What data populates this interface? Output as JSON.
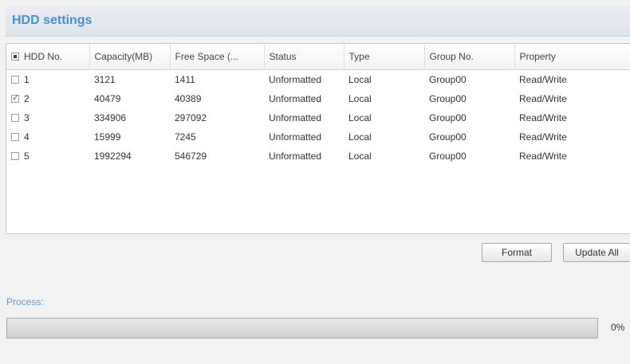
{
  "title": "HDD settings",
  "table": {
    "columns": [
      "HDD No.",
      "Capacity(MB)",
      "Free Space (...",
      "Status",
      "Type",
      "Group No.",
      "Property"
    ],
    "select_all_state": "partial",
    "rows": [
      {
        "checked": false,
        "hdd_no": "1",
        "capacity": "3121",
        "free_space": "1411",
        "status": "Unformatted",
        "type": "Local",
        "group": "Group00",
        "property": "Read/Write"
      },
      {
        "checked": true,
        "hdd_no": "2",
        "capacity": "40479",
        "free_space": "40389",
        "status": "Unformatted",
        "type": "Local",
        "group": "Group00",
        "property": "Read/Write"
      },
      {
        "checked": false,
        "hdd_no": "3",
        "capacity": "334906",
        "free_space": "297092",
        "status": "Unformatted",
        "type": "Local",
        "group": "Group00",
        "property": "Read/Write"
      },
      {
        "checked": false,
        "hdd_no": "4",
        "capacity": "15999",
        "free_space": "7245",
        "status": "Unformatted",
        "type": "Local",
        "group": "Group00",
        "property": "Read/Write"
      },
      {
        "checked": false,
        "hdd_no": "5",
        "capacity": "1992294",
        "free_space": "546729",
        "status": "Unformatted",
        "type": "Local",
        "group": "Group00",
        "property": "Read/Write"
      }
    ]
  },
  "buttons": {
    "format": "Format",
    "update_all": "Update All"
  },
  "process": {
    "label": "Process:",
    "percent_text": "0%",
    "percent": 0
  },
  "colors": {
    "title": "#4a8fd6",
    "process_label": "#5b9bd5",
    "progress_fill": "#5b9bd5"
  }
}
